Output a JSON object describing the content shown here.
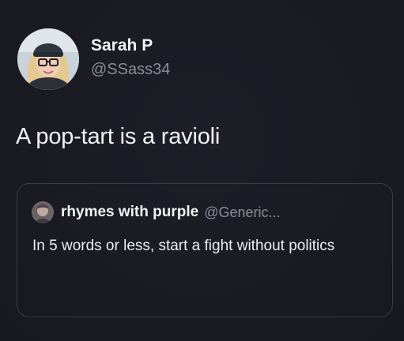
{
  "tweet": {
    "author": {
      "display_name": "Sarah P",
      "handle": "@SSass34",
      "avatar_icon": "profile-photo"
    },
    "text": "A pop-tart is a ravioli",
    "quoted_tweet": {
      "author": {
        "display_name": "rhymes with purple",
        "handle": "@Generic...",
        "avatar_icon": "profile-photo"
      },
      "text": "In 5 words or less, start a fight without politics"
    }
  },
  "colors": {
    "background": "#1b1b24",
    "primary_text": "#f2f2f4",
    "secondary_text": "#8a8d96",
    "border": "#3a3b46"
  }
}
